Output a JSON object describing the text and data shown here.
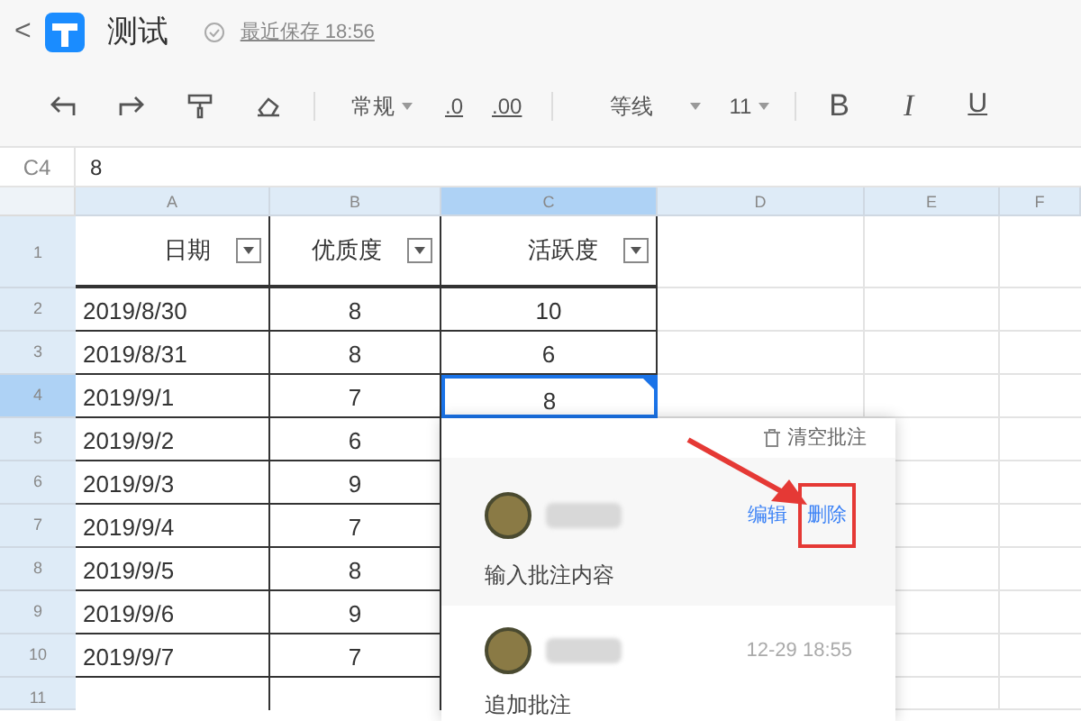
{
  "header": {
    "back": "<",
    "title": "测试",
    "save_status": "最近保存 18:56"
  },
  "toolbar": {
    "number_format": "常规",
    "decimal_less": ".0",
    "decimal_more": ".00",
    "font": "等线",
    "font_size": "11",
    "bold": "B",
    "italic": "I",
    "underline": "U"
  },
  "formula_bar": {
    "cell_reference": "C4",
    "value": "8"
  },
  "columns": [
    {
      "label": "A",
      "selected": false
    },
    {
      "label": "B",
      "selected": false
    },
    {
      "label": "C",
      "selected": true
    },
    {
      "label": "D",
      "selected": false
    },
    {
      "label": "E",
      "selected": false
    },
    {
      "label": "F",
      "selected": false
    }
  ],
  "header_row": {
    "number": "1",
    "cells": [
      "日期",
      "优质度",
      "活跃度"
    ]
  },
  "rows": [
    {
      "number": "2",
      "selected": false,
      "cells": [
        "2019/8/30",
        "8",
        "10"
      ]
    },
    {
      "number": "3",
      "selected": false,
      "cells": [
        "2019/8/31",
        "8",
        "6"
      ]
    },
    {
      "number": "4",
      "selected": true,
      "cells": [
        "2019/9/1",
        "7",
        "8"
      ]
    },
    {
      "number": "5",
      "selected": false,
      "cells": [
        "2019/9/2",
        "6",
        ""
      ]
    },
    {
      "number": "6",
      "selected": false,
      "cells": [
        "2019/9/3",
        "9",
        ""
      ]
    },
    {
      "number": "7",
      "selected": false,
      "cells": [
        "2019/9/4",
        "7",
        ""
      ]
    },
    {
      "number": "8",
      "selected": false,
      "cells": [
        "2019/9/5",
        "8",
        ""
      ]
    },
    {
      "number": "9",
      "selected": false,
      "cells": [
        "2019/9/6",
        "9",
        ""
      ]
    },
    {
      "number": "10",
      "selected": false,
      "cells": [
        "2019/9/7",
        "7",
        ""
      ]
    },
    {
      "number": "11",
      "selected": false,
      "cells": [
        "",
        "",
        ""
      ]
    }
  ],
  "comment_panel": {
    "clear_all": "清空批注",
    "comments": [
      {
        "text": "输入批注内容",
        "active": true,
        "actions": [
          "编辑",
          "删除"
        ]
      },
      {
        "text": "追加批注",
        "time": "12-29 18:55",
        "active": false
      }
    ]
  }
}
